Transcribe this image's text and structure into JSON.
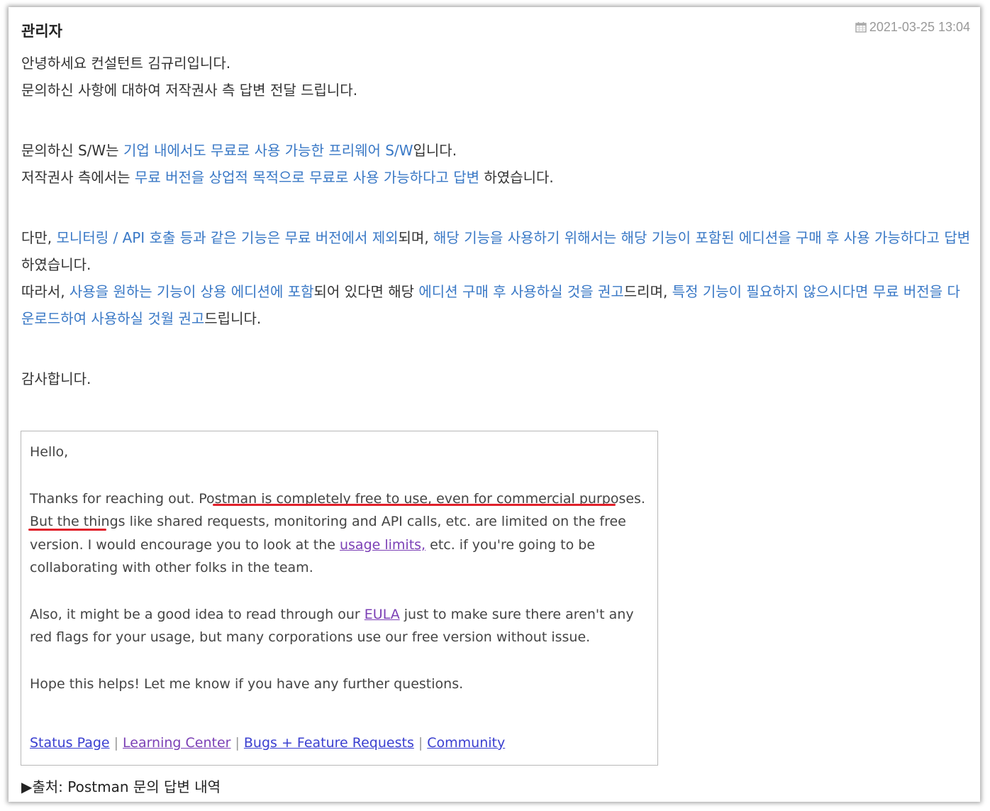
{
  "post": {
    "author": "관리자",
    "date": "2021-03-25 13:04",
    "date_icon": "calendar-icon",
    "body": {
      "l1": "안녕하세요 컨설턴트 김규리입니다.",
      "l2": "문의하신 사항에 대하여 저작권사 측 답변 전달 드립니다.",
      "l3a": "문의하신 S/W는 ",
      "l3b": "기업 내에서도 무료로 사용 가능한 프리웨어 S/W",
      "l3c": "입니다.",
      "l4a": "저작권사 측에서는 ",
      "l4b": "무료 버전을 상업적 목적으로 무료로 사용 가능하다고 답변",
      "l4c": " 하였습니다.",
      "l5a": "다만, ",
      "l5b": "모니터링 / API 호출 등과 같은 기능은 무료 버전에서 제외",
      "l5c": "되며, ",
      "l5d": "해당 기능을 사용하기 위해서는 해당 기능이 포함된 에디션을 구매 후 사용 가능하다고 답변",
      "l5e": "하였습니다.",
      "l6a": "따라서, ",
      "l6b": "사용을 원하는 기능이 상용 에디션에 포함",
      "l6c": "되어 있다면 해당 ",
      "l6d": "에디션 구매 후 사용하실 것을 권고",
      "l6e": "드리며, ",
      "l6f": "특정 기능이 필요하지 않으시다면 무료 버전을 다운로드하여 사용하실 것월 권고",
      "l6g": "드립니다.",
      "l7": "감사합니다."
    },
    "accent_color": "#3978c6"
  },
  "quote": {
    "greeting": "Hello,",
    "p1_a": "Thanks for reaching out. ",
    "p1_b": "Postman is completely free to use, even for commercial purposes.",
    "p1_c": " But the things like shared requests, monitoring and API calls, etc. are limited on the free version. I would encourage you to look at the ",
    "p1_link": "usage limits,",
    "p1_d": " etc. if you're going to be collaborating with other folks in the team.",
    "p2_a": "Also, it might be a good idea to read through our ",
    "p2_link": "EULA",
    "p2_b": " just to make sure there aren't any red flags for your usage, but many corporations use our free version without issue.",
    "p3": "Hope this helps! Let me know if you have any further questions.",
    "links": [
      "Status Page",
      "Learning Center",
      "Bugs + Feature Requests",
      "Community"
    ],
    "separator": "|",
    "highlight_color": "#e0202a"
  },
  "caption": "▶출처: Postman 문의 답변 내역"
}
